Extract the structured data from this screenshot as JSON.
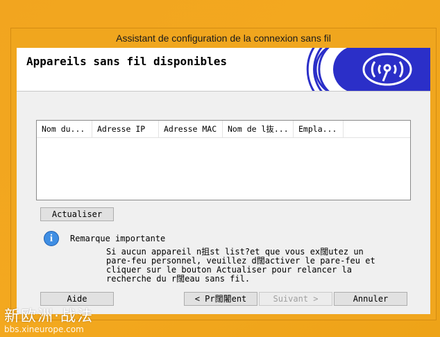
{
  "window": {
    "title": "Assistant de configuration de la connexion sans fil"
  },
  "banner": {
    "title": "Appareils sans fil disponibles",
    "icon": "wireless-icon"
  },
  "device_list": {
    "columns": [
      "Nom du...",
      "Adresse IP",
      "Adresse MAC",
      "Nom de l抜...",
      "Empla..."
    ],
    "rows": []
  },
  "buttons": {
    "refresh": "Actualiser",
    "help": "Aide",
    "back": "< Pr闊闍ent",
    "next": "Suivant >",
    "cancel": "Annuler"
  },
  "note": {
    "icon": "info-icon",
    "title": "Remarque importante",
    "line1": "Si aucun appareil n抯st list?et que vous ex闊utez un",
    "line2": "pare-feu personnel, veuillez d闊activer le pare-feu et",
    "line3": "cliquer sur le bouton Actualiser pour relancer la",
    "line4": "recherche du r闊eau sans fil."
  },
  "watermark": {
    "text": "新欧洲·战法",
    "url": "bbs.xineurope.com"
  },
  "colors": {
    "desktop": "#f2a51f",
    "banner_art": "#2b2fc8"
  }
}
